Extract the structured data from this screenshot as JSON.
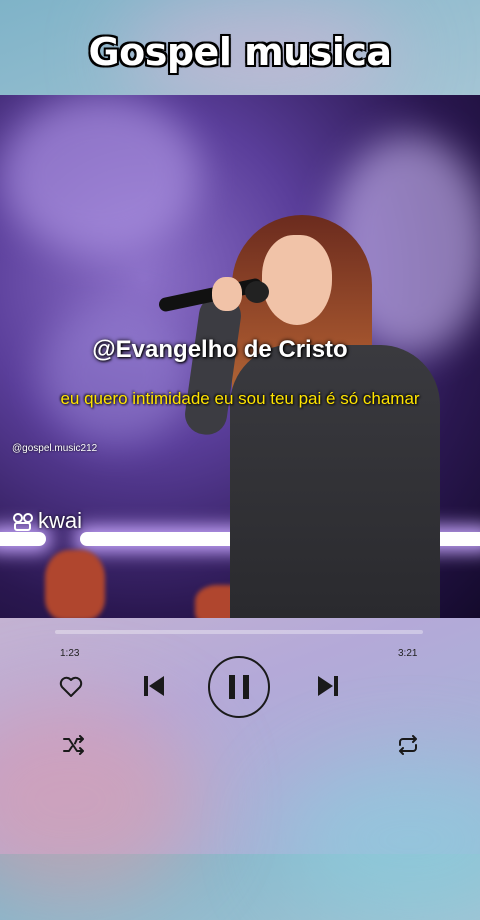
{
  "title": "Gospel musica",
  "video": {
    "overlay_handle": "@Evangelho de Cristo",
    "lyrics": "eu quero intimidade eu sou teu pai é só chamar",
    "watermark_brand": "kwai",
    "watermark_user": "@gospel.music212"
  },
  "player": {
    "elapsed": "1:23",
    "duration": "3:21",
    "progress_fraction": 0.0,
    "icons": [
      "heart-icon",
      "previous-icon",
      "pause-icon",
      "next-icon",
      "shuffle-icon",
      "repeat-icon"
    ]
  }
}
